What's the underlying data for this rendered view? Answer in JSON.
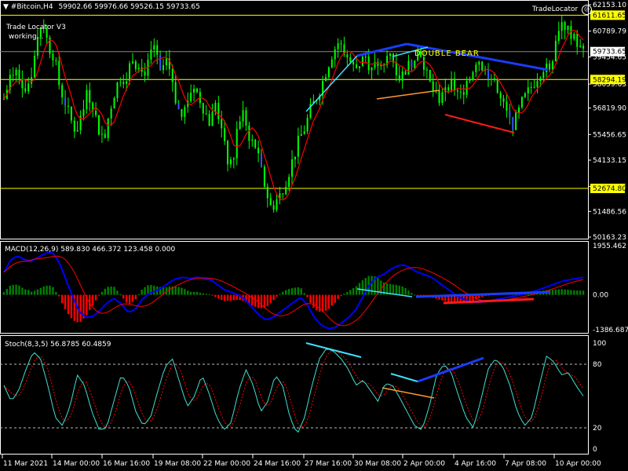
{
  "window": {
    "symbol_title": "#Bitcoin,H4",
    "ohlc": "59902.66 59976.66 59526.15 59733.65",
    "brand": "TradeLocator",
    "indicator_label": "Trade Locator V3",
    "indicator_status": "working..."
  },
  "colors": {
    "background": "#000000",
    "bull_candle": "#00ff00",
    "bear_candle": "#00ff00",
    "fast_ma": "#ff0000",
    "level_line": "#ffff00",
    "macd_line": "#0000ff",
    "signal_line": "#ff0000",
    "hist_up": "#008000",
    "hist_down": "#ff0000",
    "stoch_main": "#40e0d0",
    "stoch_signal": "#ff0000",
    "div_cyan": "#40e0ff",
    "div_blue": "#1a3cff",
    "div_orange": "#ff9933",
    "div_red": "#ff1a1a",
    "label_box": "#ffff00"
  },
  "chart_data": [
    {
      "type": "candlestick",
      "panel": "price",
      "symbol": "#Bitcoin",
      "timeframe": "H4",
      "y_ticks": [
        "62153.10",
        "60789.79",
        "59454.65",
        "58059.63",
        "56819.90",
        "55456.65",
        "54133.15",
        "52769.45",
        "51486.56",
        "50163.23"
      ],
      "y_range": [
        50163.23,
        62153.1
      ],
      "last_price": "59733.65",
      "levels": [
        {
          "value": 61611.65,
          "label": "61611.65"
        },
        {
          "value": 58294.19,
          "label": "58294.19"
        },
        {
          "value": 52674.8,
          "label": "52674.80"
        }
      ],
      "annotations": [
        {
          "text": "DOUBLE BEAR"
        }
      ],
      "close_path": [
        57300,
        58200,
        58900,
        58400,
        57600,
        58700,
        60700,
        61300,
        60000,
        59500,
        57900,
        57100,
        56200,
        55600,
        56800,
        57600,
        57000,
        55700,
        55300,
        56700,
        57800,
        58500,
        58300,
        59600,
        58900,
        58600,
        59100,
        60100,
        58500,
        59300,
        58700,
        57000,
        56300,
        57300,
        58000,
        57400,
        56700,
        56000,
        57100,
        55800,
        54200,
        53700,
        56100,
        56600,
        55400,
        55000,
        53800,
        52600,
        51600,
        52100,
        52600,
        53400,
        54300,
        55200,
        55800,
        56700,
        57300,
        58000,
        58900,
        59700,
        60200,
        59800,
        59300,
        58800,
        59200,
        59500,
        58700,
        59200,
        58600,
        59700,
        59200,
        58400,
        58800,
        59100,
        59800,
        59600,
        58400,
        57700,
        57200,
        58000,
        58100,
        57800,
        57400,
        58200,
        58700,
        59500,
        58900,
        58600,
        58100,
        57300,
        56700,
        55900,
        56300,
        57100,
        57600,
        58100,
        58600,
        59000,
        58600,
        60400,
        61400,
        60900,
        60600,
        59900,
        59730
      ]
    },
    {
      "type": "macd",
      "panel": "macd",
      "label": "MACD(12,26,9) 589.830 466.372 123.458 0.000",
      "y_ticks": [
        "1955.462",
        "0.00",
        "-1386.687"
      ],
      "y_range": [
        -1386.687,
        1955.462
      ],
      "macd_path": [
        900,
        1400,
        1550,
        1400,
        1350,
        1500,
        1650,
        1700,
        1300,
        600,
        -100,
        -700,
        -900,
        -850,
        -600,
        -300,
        -150,
        -350,
        -700,
        -600,
        -200,
        50,
        150,
        300,
        500,
        650,
        700,
        650,
        700,
        650,
        600,
        400,
        200,
        100,
        0,
        -200,
        -500,
        -800,
        -1000,
        -900,
        -700,
        -500,
        -300,
        -100,
        -400,
        -900,
        -1200,
        -1350,
        -1300,
        -1100,
        -900,
        -600,
        -100,
        400,
        700,
        800,
        1000,
        1150,
        1200,
        1050,
        900,
        800,
        700,
        500,
        300,
        100,
        -100,
        -200,
        -300,
        -300,
        -250,
        -200,
        -150,
        -100,
        -50,
        0,
        100,
        150,
        250,
        350,
        450,
        550,
        600,
        650,
        700
      ]
    },
    {
      "type": "stochastic",
      "panel": "stoch",
      "label": "Stoch(8,3,5) 56.8785 60.4859",
      "y_ticks": [
        "100",
        "80",
        "20",
        "0"
      ],
      "y_range": [
        0,
        100
      ],
      "levels": [
        80,
        20
      ],
      "k_path": [
        60,
        45,
        55,
        75,
        92,
        85,
        60,
        30,
        22,
        40,
        70,
        60,
        35,
        18,
        20,
        45,
        70,
        60,
        35,
        22,
        30,
        55,
        78,
        85,
        62,
        40,
        50,
        70,
        52,
        30,
        18,
        25,
        55,
        75,
        60,
        35,
        45,
        70,
        60,
        30,
        14,
        30,
        60,
        85,
        95,
        92,
        85,
        75,
        60,
        65,
        55,
        45,
        62,
        60,
        48,
        35,
        22,
        18,
        40,
        70,
        80,
        72,
        50,
        30,
        20,
        45,
        75,
        85,
        78,
        60,
        35,
        22,
        30,
        60,
        88,
        82,
        70,
        72,
        60,
        50
      ]
    }
  ],
  "time_axis": [
    "11 Mar 2021",
    "14 Mar 00:00",
    "16 Mar 16:00",
    "19 Mar 08:00",
    "22 Mar 00:00",
    "24 Mar 16:00",
    "27 Mar 16:00",
    "30 Mar 08:00",
    "2 Apr 00:00",
    "4 Apr 16:00",
    "7 Apr 08:00",
    "10 Apr 00:00"
  ]
}
